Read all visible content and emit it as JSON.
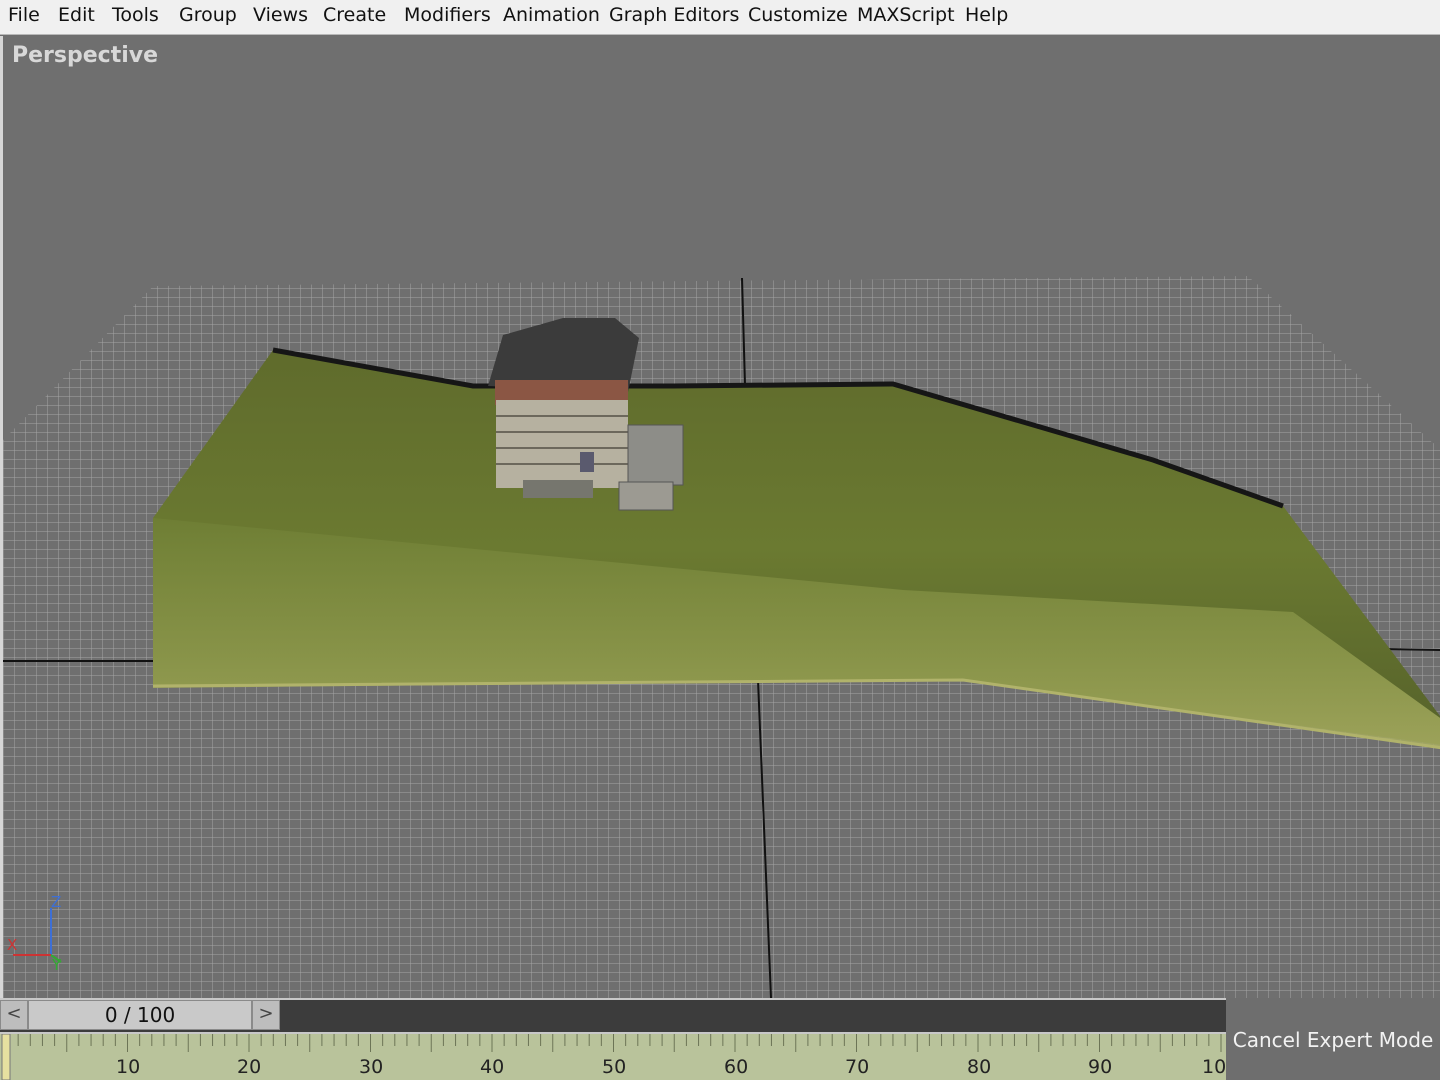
{
  "menu": [
    "File",
    "Edit",
    "Tools",
    "Group",
    "Views",
    "Create",
    "Modifiers",
    "Animation",
    "Graph Editors",
    "Customize",
    "MAXScript",
    "Help"
  ],
  "viewport": {
    "label": "Perspective",
    "axes": {
      "z": "Z",
      "x": "X",
      "y": "Y"
    },
    "colors": {
      "background": "#6f6f6f",
      "grid": "#a9a9a9",
      "terrain": "#6e7d32",
      "terrain_edge": "#a8ac5e"
    }
  },
  "timeline": {
    "frame_display": "0 / 100",
    "prev_glyph": "<",
    "next_glyph": ">",
    "ticks": [
      "10",
      "20",
      "30",
      "40",
      "50",
      "60",
      "70",
      "80",
      "90",
      "10"
    ]
  },
  "expert_mode": {
    "label": "Cancel Expert Mode"
  }
}
